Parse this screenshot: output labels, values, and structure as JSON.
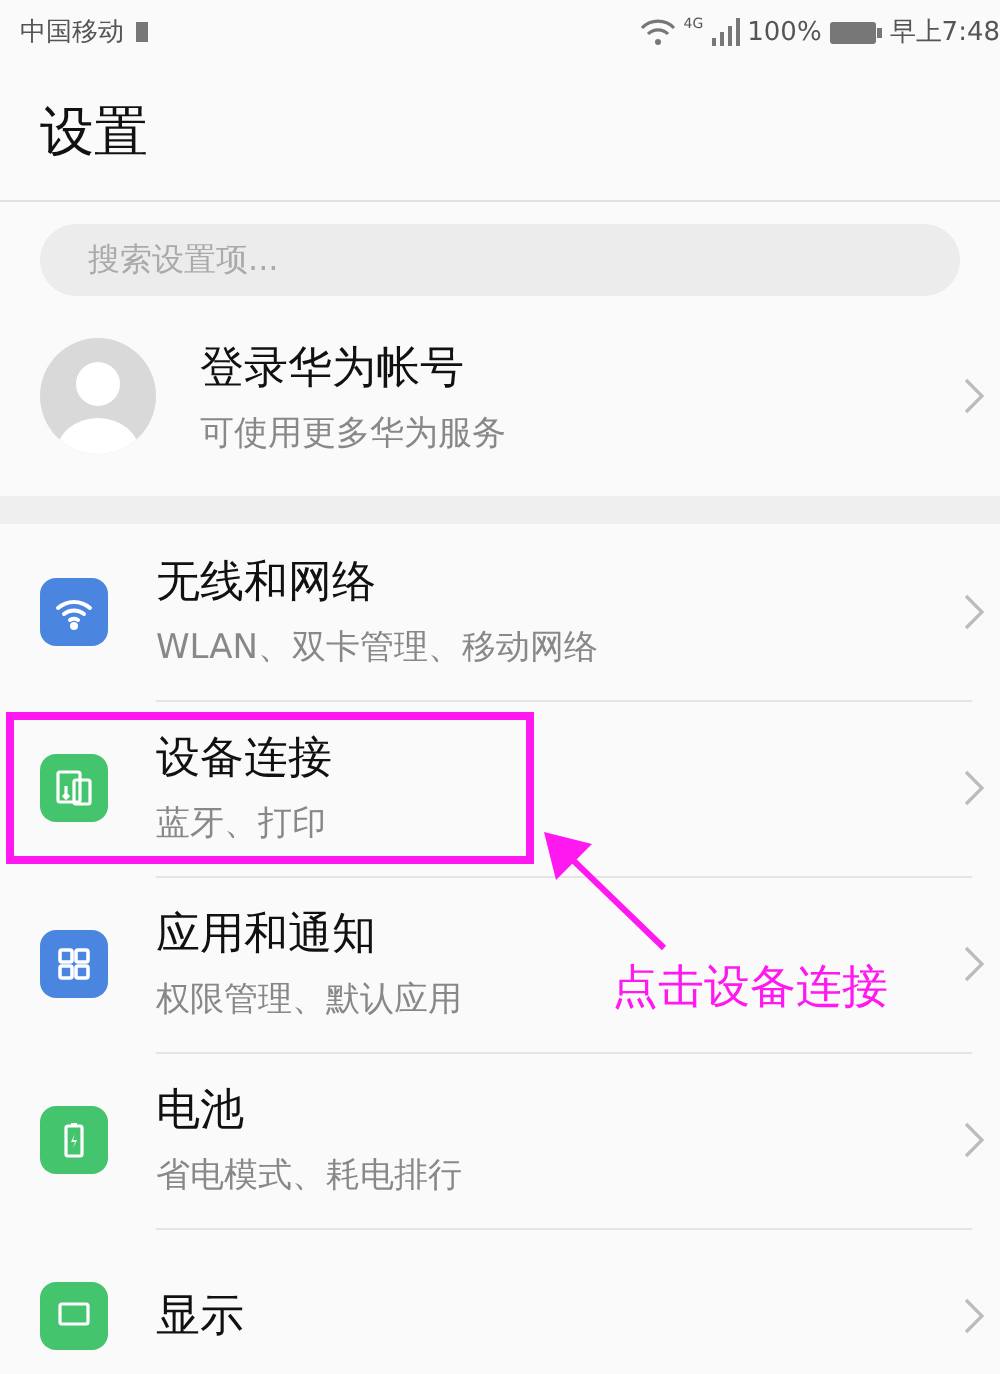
{
  "status_bar": {
    "carrier": "中国移动",
    "network": "4G",
    "battery": "100%",
    "time": "早上7:48"
  },
  "title": "设置",
  "search": {
    "placeholder": "搜索设置项..."
  },
  "account": {
    "title": "登录华为帐号",
    "subtitle": "可使用更多华为服务"
  },
  "items": [
    {
      "kind": "wifi",
      "title": "无线和网络",
      "subtitle": "WLAN、双卡管理、移动网络",
      "highlighted": false
    },
    {
      "kind": "devices",
      "title": "设备连接",
      "subtitle": "蓝牙、打印",
      "highlighted": true
    },
    {
      "kind": "apps",
      "title": "应用和通知",
      "subtitle": "权限管理、默认应用",
      "highlighted": false
    },
    {
      "kind": "battery",
      "title": "电池",
      "subtitle": "省电模式、耗电排行",
      "highlighted": false
    },
    {
      "kind": "display",
      "title": "显示",
      "highlighted": false
    }
  ],
  "annotation": {
    "text": "点击设备连接"
  }
}
